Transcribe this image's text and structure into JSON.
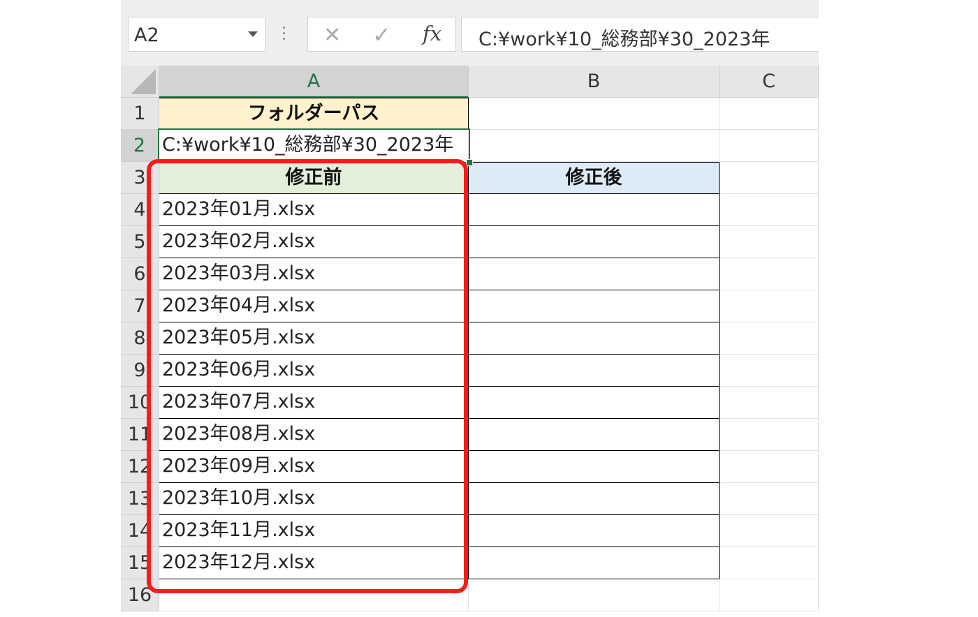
{
  "namebox": {
    "value": "A2"
  },
  "formula_bar": {
    "cancel_icon": "✕",
    "enter_icon": "✓",
    "fx_label": "fx",
    "value": "C:¥work¥10_総務部¥30_2023年"
  },
  "columns": [
    "A",
    "B",
    "C"
  ],
  "rows": [
    "1",
    "2",
    "3",
    "4",
    "5",
    "6",
    "7",
    "8",
    "9",
    "10",
    "11",
    "12",
    "13",
    "14",
    "15",
    "16"
  ],
  "cells": {
    "A1": "フォルダーパス",
    "A2": "C:¥work¥10_総務部¥30_2023年",
    "A3": "修正前",
    "B3": "修正後",
    "A4": "2023年01月.xlsx",
    "A5": "2023年02月.xlsx",
    "A6": "2023年03月.xlsx",
    "A7": "2023年04月.xlsx",
    "A8": "2023年05月.xlsx",
    "A9": "2023年06月.xlsx",
    "A10": "2023年07月.xlsx",
    "A11": "2023年08月.xlsx",
    "A12": "2023年09月.xlsx",
    "A13": "2023年10月.xlsx",
    "A14": "2023年11月.xlsx",
    "A15": "2023年12月.xlsx"
  },
  "colors": {
    "folder_header_fill": "#fff2cc",
    "before_header_fill": "#e2efda",
    "after_header_fill": "#ddebf7",
    "selection_green": "#217346",
    "highlight_red": "#ff1a1a"
  },
  "selected_cell": "A2"
}
